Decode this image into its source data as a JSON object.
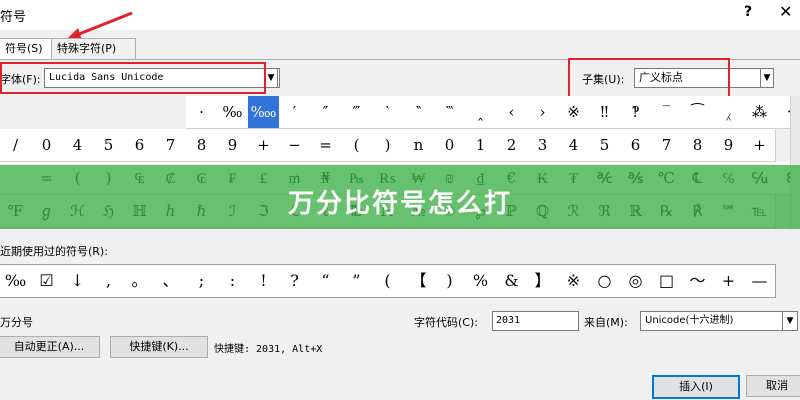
{
  "window": {
    "title": "符号",
    "help": "?",
    "close": "✕"
  },
  "tabs": [
    {
      "label": "符号(S)"
    },
    {
      "label": "特殊字符(P)"
    }
  ],
  "font": {
    "label": "字体(F):",
    "value": "Lucida Sans Unicode"
  },
  "subset": {
    "label": "子集(U):",
    "value": "广义标点"
  },
  "banner": {
    "text": "万分比符号怎么打"
  },
  "grid_rows": [
    [
      "·",
      "‰",
      "‱",
      "′",
      "″",
      "‴",
      "‵",
      "‶",
      "‷",
      "‸",
      "‹",
      "›",
      "※",
      "‼",
      "‽",
      "‾",
      "⁀",
      "⁁",
      "⁂",
      "⁃",
      ""
    ],
    [
      "/",
      "0",
      "4",
      "5",
      "6",
      "7",
      "8",
      "9",
      "+",
      "−",
      "=",
      "(",
      ")",
      "n",
      "0",
      "1",
      "2",
      "3",
      "4",
      "5",
      "6",
      "7",
      "8",
      "9",
      "+"
    ],
    [
      "",
      "=",
      "(",
      ")",
      "₠",
      "₡",
      "₢",
      "₣",
      "₤",
      "₥",
      "₦",
      "₧",
      "₨",
      "₩",
      "₪",
      "₫",
      "€",
      "₭",
      "₮",
      "℀",
      "℁",
      "℃",
      "℄",
      "℅",
      "℆",
      "ℇ",
      "℈"
    ],
    [
      "℉",
      "ℊ",
      "ℋ",
      "ℌ",
      "ℍ",
      "ℎ",
      "ℏ",
      "ℐ",
      "ℑ",
      "ℒ",
      "ℓ",
      "℔",
      "ℕ",
      "№",
      "℗",
      "℘",
      "ℙ",
      "ℚ",
      "ℛ",
      "ℜ",
      "ℝ",
      "℞",
      "℟",
      "℠",
      "℡"
    ]
  ],
  "recent": {
    "label": "近期使用过的符号(R):",
    "symbols": [
      "‰",
      "☑",
      "↓",
      ",",
      "。",
      "、",
      ";",
      ":",
      "!",
      "?",
      "“",
      "”",
      "(",
      "【",
      ")",
      "%",
      "&",
      "】",
      "※",
      "○",
      "◎",
      "□",
      "～",
      "+",
      "—"
    ]
  },
  "unicode_name": "万分号",
  "code": {
    "label": "字符代码(C):",
    "value": "2031"
  },
  "from": {
    "label": "来自(M):",
    "value": "Unicode(十六进制)"
  },
  "buttons": {
    "autocorrect": "自动更正(A)...",
    "shortcut_key": "快捷键(K)...",
    "shortcut_text": "快捷键: 2031, Alt+X",
    "insert": "插入(I)",
    "cancel": "取消"
  }
}
